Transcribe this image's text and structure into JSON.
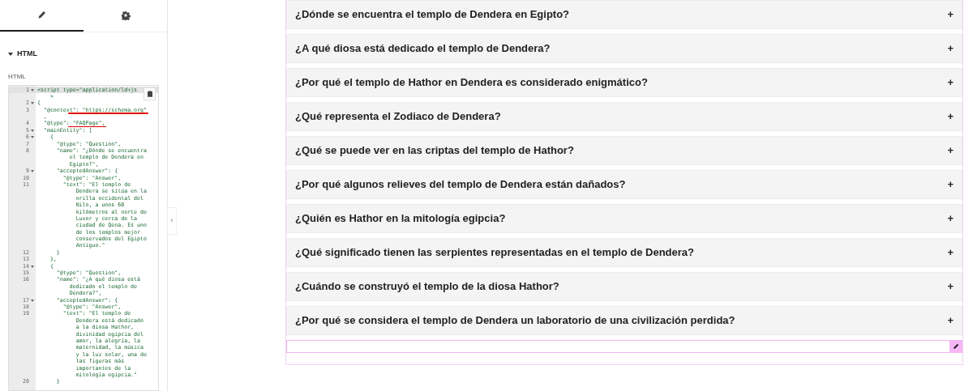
{
  "sidebar": {
    "tabs": [
      {
        "selected": true
      },
      {
        "selected": false
      }
    ],
    "collapse_handle": "‹",
    "section": {
      "title": "HTML",
      "expanded": true
    },
    "field_label": "HTML",
    "code_lines": [
      {
        "number": "1",
        "fold": true,
        "underline": false,
        "text": [
          "<script type=\"application/ld+js",
          "    >"
        ]
      },
      {
        "number": "2",
        "fold": true,
        "underline": false,
        "text": [
          "{"
        ]
      },
      {
        "number": "3",
        "fold": false,
        "underline": true,
        "text": [
          "  \"@context\": \"https://schema.org\"",
          "  ,"
        ]
      },
      {
        "number": "4",
        "fold": false,
        "underline": true,
        "text": [
          "  \"@type\": \"FAQPage\","
        ]
      },
      {
        "number": "5",
        "fold": true,
        "underline": false,
        "text": [
          "  \"mainEntity\": ["
        ]
      },
      {
        "number": "6",
        "fold": true,
        "underline": false,
        "text": [
          "    {"
        ]
      },
      {
        "number": "7",
        "fold": false,
        "underline": false,
        "text": [
          "      \"@type\": \"Question\","
        ]
      },
      {
        "number": "8",
        "fold": false,
        "underline": false,
        "text": [
          "      \"name\": \"¿Dónde se encuentra",
          "          el templo de Dendera en",
          "          Egipto?\","
        ]
      },
      {
        "number": "9",
        "fold": true,
        "underline": false,
        "text": [
          "      \"acceptedAnswer\": {"
        ]
      },
      {
        "number": "10",
        "fold": false,
        "underline": false,
        "text": [
          "        \"@type\": \"Answer\","
        ]
      },
      {
        "number": "11",
        "fold": false,
        "underline": false,
        "text": [
          "        \"text\": \"El templo de",
          "            Dendera se sitúa en la",
          "            orilla occidental del",
          "            Nilo, a unos 60",
          "            kilómetros al norte de",
          "            Luxor y cerca de la",
          "            ciudad de Qena. Es uno",
          "            de los templos mejor",
          "            conservados del Egipto",
          "            Antiguo.\""
        ]
      },
      {
        "number": "12",
        "fold": false,
        "underline": false,
        "text": [
          "      }"
        ]
      },
      {
        "number": "13",
        "fold": false,
        "underline": false,
        "text": [
          "    },"
        ]
      },
      {
        "number": "14",
        "fold": true,
        "underline": false,
        "text": [
          "    {"
        ]
      },
      {
        "number": "15",
        "fold": false,
        "underline": false,
        "text": [
          "      \"@type\": \"Question\","
        ]
      },
      {
        "number": "16",
        "fold": false,
        "underline": false,
        "text": [
          "      \"name\": \"¿A qué diosa está",
          "          dedicado el templo de",
          "          Dendera?\","
        ]
      },
      {
        "number": "17",
        "fold": true,
        "underline": false,
        "text": [
          "      \"acceptedAnswer\": {"
        ]
      },
      {
        "number": "18",
        "fold": false,
        "underline": false,
        "text": [
          "        \"@type\": \"Answer\","
        ]
      },
      {
        "number": "19",
        "fold": false,
        "underline": false,
        "text": [
          "        \"text\": \"El templo de",
          "            Dendera está dedicado",
          "            a la diosa Hathor,",
          "            divinidad egipcia del",
          "            amor, la alegría, la",
          "            maternidad, la música",
          "            y la luz solar, una de",
          "            las figuras más",
          "            importantes de la",
          "            mitología egipcia.\""
        ]
      },
      {
        "number": "20",
        "fold": false,
        "underline": false,
        "text": [
          "      }"
        ]
      }
    ]
  },
  "faq": {
    "items": [
      {
        "question": "¿Dónde se encuentra el templo de Dendera en Egipto?",
        "toggle": "+"
      },
      {
        "question": "¿A qué diosa está dedicado el templo de Dendera?",
        "toggle": "+"
      },
      {
        "question": "¿Por qué el templo de Hathor en Dendera es considerado enigmático?",
        "toggle": "+"
      },
      {
        "question": "¿Qué representa el Zodiaco de Dendera?",
        "toggle": "+"
      },
      {
        "question": "¿Qué se puede ver en las criptas del templo de Hathor?",
        "toggle": "+"
      },
      {
        "question": "¿Por qué algunos relieves del templo de Dendera están dañados?",
        "toggle": "+"
      },
      {
        "question": "¿Quién es Hathor en la mitología egipcia?",
        "toggle": "+"
      },
      {
        "question": "¿Qué significado tienen las serpientes representadas en el templo de Dendera?",
        "toggle": "+"
      },
      {
        "question": "¿Cuándo se construyó el templo de la diosa Hathor?",
        "toggle": "+"
      },
      {
        "question": "¿Por qué se considera el templo de Dendera un laboratorio de una civilización perdida?",
        "toggle": "+"
      }
    ]
  }
}
